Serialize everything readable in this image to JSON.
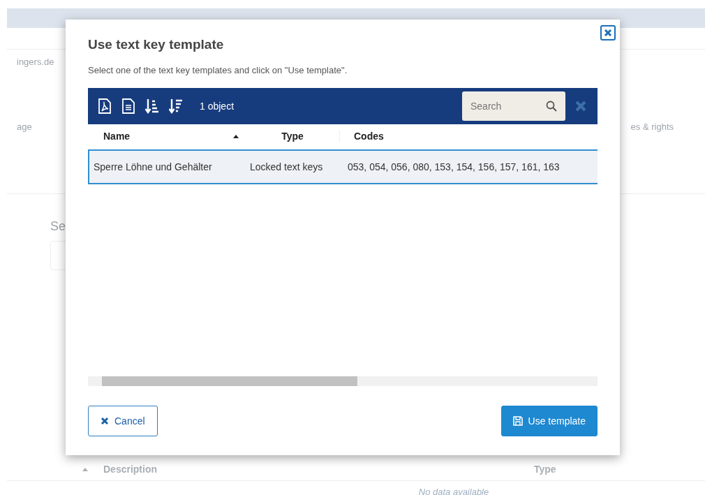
{
  "background": {
    "account": "ingers.de",
    "tab_left": "age",
    "tab_right": "es & rights",
    "section_title": "Se",
    "table_columns": [
      {
        "label": "Description",
        "sorted": true
      },
      {
        "label": "Type",
        "sorted": false
      }
    ],
    "empty_message": "No data available"
  },
  "dialog": {
    "title": "Use text key template",
    "instruction": "Select one of the text key templates and click on \"Use template\".",
    "toolbar": {
      "count": "1 object",
      "search": {
        "placeholder": "Search"
      }
    },
    "columns": [
      {
        "label": "Name",
        "sorted": true
      },
      {
        "label": "Type",
        "sorted": false
      },
      {
        "label": "Codes",
        "sorted": false
      }
    ],
    "rows": [
      {
        "cells": [
          "Sperre Löhne und Gehälter",
          "Locked text keys",
          "053, 054, 056, 080, 153, 154, 156, 157, 161, 163"
        ],
        "selected": true
      }
    ],
    "buttons": [
      {
        "label": "Cancel",
        "kind": "cancel"
      },
      {
        "label": "Use template",
        "kind": "primary"
      }
    ]
  }
}
